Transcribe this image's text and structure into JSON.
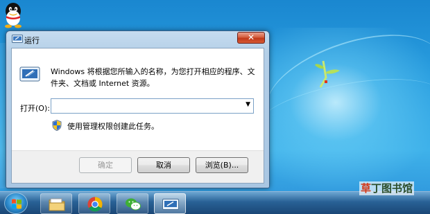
{
  "dialog": {
    "title": "运行",
    "close_glyph": "✕",
    "description": "Windows 将根据您所输入的名称，为您打开相应的程序、文件夹、文档或 Internet 资源。",
    "open_label": "打开(O):",
    "open_value": "",
    "admin_note": "使用管理权限创建此任务。",
    "buttons": {
      "ok": "确定",
      "cancel": "取消",
      "browse": "浏览(B)..."
    }
  },
  "taskbar": {
    "items": [
      "start-orb",
      "explorer-icon",
      "chrome-icon",
      "wechat-icon",
      "run-icon"
    ],
    "active_item": "run-icon"
  },
  "watermark": {
    "part1": "草",
    "part2": "丁图书馆"
  },
  "colors": {
    "desktop": "#2a9fe0",
    "close_button": "#c1391a",
    "accent": "#3a5f86"
  }
}
